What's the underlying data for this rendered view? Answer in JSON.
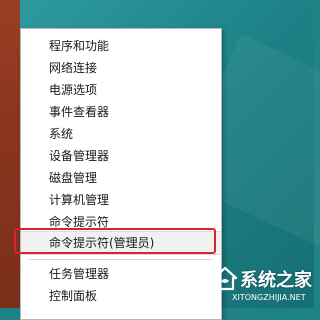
{
  "context_menu": {
    "items": [
      {
        "label": "程序和功能"
      },
      {
        "label": "网络连接"
      },
      {
        "label": "电源选项"
      },
      {
        "label": "事件查看器"
      },
      {
        "label": "系统"
      },
      {
        "label": "设备管理器"
      },
      {
        "label": "磁盘管理"
      },
      {
        "label": "计算机管理"
      },
      {
        "label": "命令提示符"
      },
      {
        "label": "命令提示符(管理员)"
      },
      {
        "label": "任务管理器"
      },
      {
        "label": "控制面板"
      }
    ]
  },
  "watermark": {
    "text": "系统之家",
    "url": "XITONGZHIJIA.NET"
  },
  "colors": {
    "highlight_border": "#d9232e",
    "desktop_teal": "#1d8388",
    "desktop_brown": "#8a351f"
  }
}
